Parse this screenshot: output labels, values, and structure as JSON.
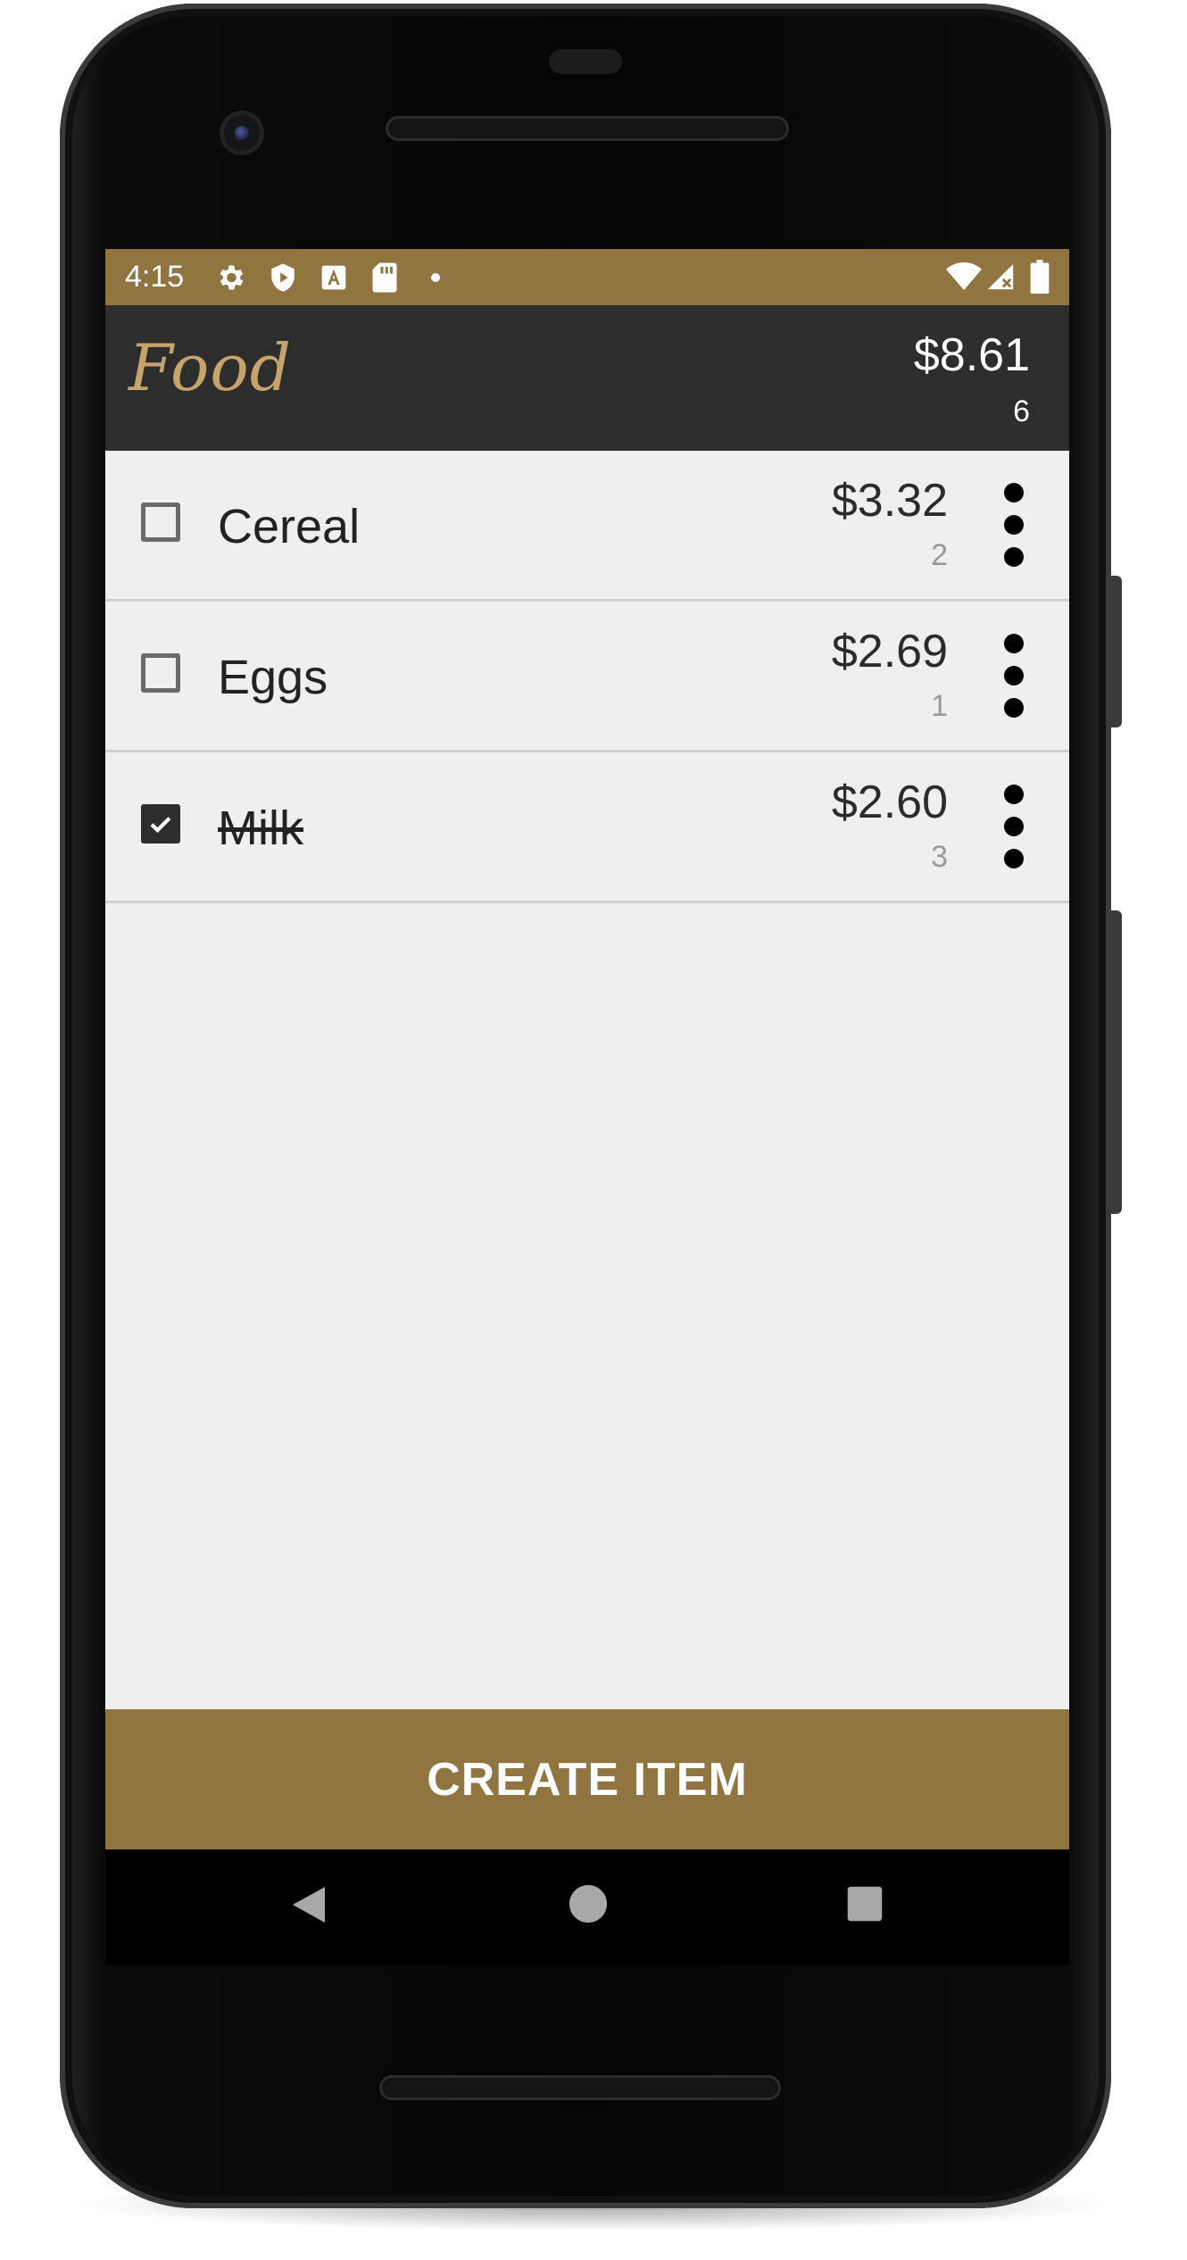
{
  "status_bar": {
    "time": "4:15",
    "left_icons": [
      "gear-icon",
      "shield-icon",
      "font-a-icon",
      "sd-card-icon",
      "dot-icon"
    ],
    "right_icons": [
      "wifi-icon",
      "signal-icon",
      "battery-icon"
    ]
  },
  "app_bar": {
    "title": "Food",
    "total": "$8.61",
    "count": "6"
  },
  "items": [
    {
      "name": "Cereal",
      "price": "$3.32",
      "qty": "2",
      "checked": false
    },
    {
      "name": "Eggs",
      "price": "$2.69",
      "qty": "1",
      "checked": false
    },
    {
      "name": "Milk",
      "price": "$2.60",
      "qty": "3",
      "checked": true
    }
  ],
  "create_button": {
    "label": "CREATE ITEM"
  },
  "colors": {
    "accent": "#917541",
    "app_bar": "#2d2d2d",
    "title": "#c6a46a",
    "background": "#efefef"
  },
  "nav": [
    "back-icon",
    "home-icon",
    "recents-icon"
  ]
}
